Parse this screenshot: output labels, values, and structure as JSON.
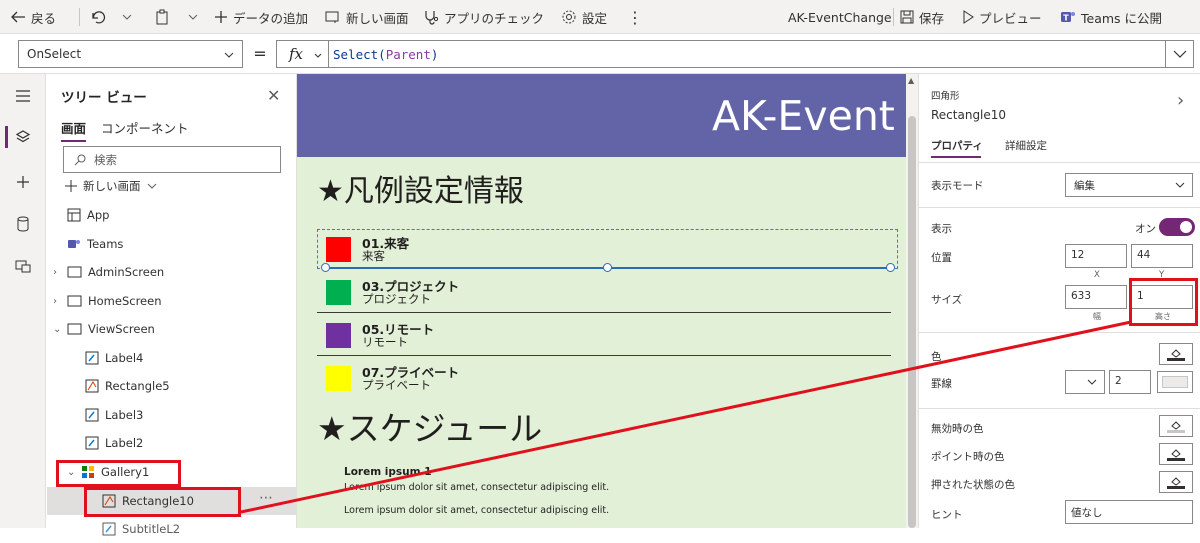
{
  "cmdbar": {
    "back": "戻る",
    "add_data": "データの追加",
    "new_screen": "新しい画面",
    "app_check": "アプリのチェック",
    "settings": "設定",
    "app_name": "AK-EventChange",
    "save": "保存",
    "preview": "プレビュー",
    "teams_publish": "Teams に公開"
  },
  "formula_bar": {
    "property": "OnSelect",
    "equals": "=",
    "fx": "fx",
    "func": "Select",
    "open": "(",
    "arg": "Parent",
    "close": ")"
  },
  "tree": {
    "title": "ツリー ビュー",
    "tab_screen": "画面",
    "tab_components": "コンポーネント",
    "search_placeholder": "検索",
    "new_screen": "新しい画面",
    "nodes": [
      "App",
      "Teams",
      "AdminScreen",
      "HomeScreen",
      "ViewScreen",
      "Label4",
      "Rectangle5",
      "Label3",
      "Label2",
      "Gallery1",
      "Rectangle10",
      "SubtitleL2"
    ]
  },
  "canvas": {
    "app_title": "AK-Event",
    "heading1": "★凡例設定情報",
    "legend": [
      {
        "title": "01.来客",
        "sub": "来客",
        "color": "#ff0000"
      },
      {
        "title": "03.プロジェクト",
        "sub": "プロジェクト",
        "color": "#00b050"
      },
      {
        "title": "05.リモート",
        "sub": "リモート",
        "color": "#7030a0"
      },
      {
        "title": "07.プライベート",
        "sub": "プライベート",
        "color": "#ffff00"
      }
    ],
    "heading2": "★スケジュール",
    "lorem_title": "Lorem ipsum 1",
    "lorem_line1": "Lorem ipsum dolor sit amet, consectetur adipiscing elit.",
    "lorem_line2": "Lorem ipsum dolor sit amet, consectetur adipiscing elit."
  },
  "props": {
    "type": "四角形",
    "name": "Rectangle10",
    "tab_properties": "プロパティ",
    "tab_advanced": "詳細設定",
    "display_mode_label": "表示モード",
    "display_mode_value": "編集",
    "visible_label": "表示",
    "visible_state": "オン",
    "position_label": "位置",
    "x_value": "12",
    "y_value": "44",
    "x_caption": "X",
    "y_caption": "Y",
    "size_label": "サイズ",
    "width_value": "633",
    "height_value": "1",
    "width_caption": "幅",
    "height_caption": "高さ",
    "color_label": "色",
    "border_label": "罫線",
    "border_value": "2",
    "disabled_color_label": "無効時の色",
    "hover_color_label": "ポイント時の色",
    "pressed_color_label": "押された状態の色",
    "tooltip_label": "ヒント",
    "tooltip_value": "値なし"
  },
  "colors": {
    "accent": "#742774",
    "header": "#6264a7",
    "canvas_bg": "#e3f0d8",
    "highlight": "#e0101c",
    "selection": "#2b6cb0"
  }
}
